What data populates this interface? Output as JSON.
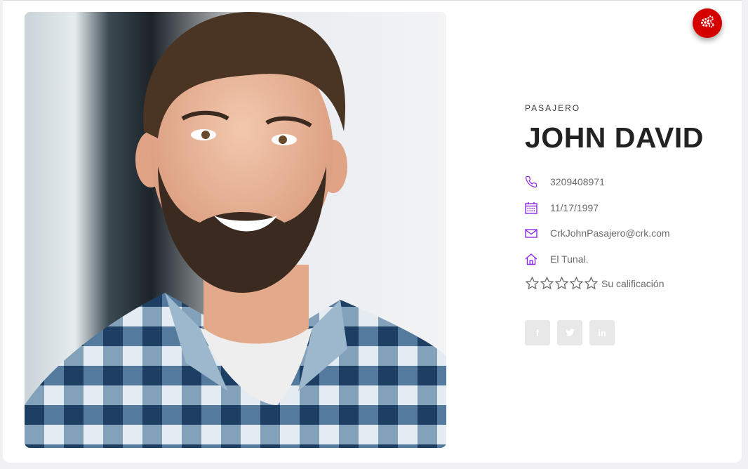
{
  "profile": {
    "role": "PASAJERO",
    "name": "JOHN DAVID",
    "phone": "3209408971",
    "birthdate": "11/17/1997",
    "email": "CrkJohnPasajero@crk.com",
    "address": "El Tunal.",
    "rating_label": "Su calificación",
    "rating_stars": 0,
    "rating_max": 5
  },
  "icons": {
    "settings": "gears-icon",
    "phone": "phone-icon",
    "birthdate": "calendar-icon",
    "email": "envelope-icon",
    "address": "home-icon",
    "star": "star-outline-icon",
    "facebook": "facebook-icon",
    "twitter": "twitter-icon",
    "linkedin": "linkedin-icon"
  },
  "social": {
    "facebook": "f",
    "linkedin": "in"
  },
  "colors": {
    "accent": "#8a2be2",
    "settings_button": "#d40000",
    "name_text": "#222222",
    "detail_text": "#6a6a6a",
    "social_bg": "#e8e8e8"
  }
}
